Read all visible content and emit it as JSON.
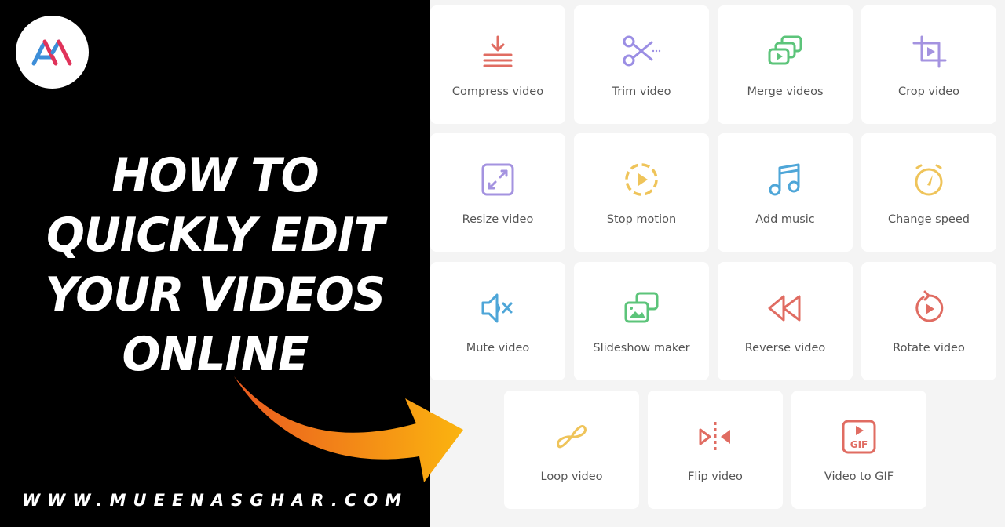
{
  "brand": {
    "logo_text": "AM",
    "logo_colors": {
      "a": "#3d8ed8",
      "m": "#e0335a"
    }
  },
  "headline": {
    "lines": [
      "HOW TO",
      "QUICKLY EDIT",
      "YOUR VIDEOS",
      "ONLINE"
    ]
  },
  "website": "WWW.MUEENASGHAR.COM",
  "arrow": {
    "gradient_start": "#ea5a1f",
    "gradient_end": "#fbb40f"
  },
  "tools": [
    {
      "label": "Compress video",
      "icon": "compress-icon",
      "color": "#e06c62"
    },
    {
      "label": "Trim video",
      "icon": "scissors-icon",
      "color": "#9b8ee4"
    },
    {
      "label": "Merge videos",
      "icon": "merge-icon",
      "color": "#5cc47a"
    },
    {
      "label": "Crop video",
      "icon": "crop-icon",
      "color": "#a493e0"
    },
    {
      "label": "Resize video",
      "icon": "resize-icon",
      "color": "#a493e0"
    },
    {
      "label": "Stop motion",
      "icon": "stop-motion-icon",
      "color": "#efc45a"
    },
    {
      "label": "Add music",
      "icon": "music-note-icon",
      "color": "#4ea6d8"
    },
    {
      "label": "Change speed",
      "icon": "stopwatch-icon",
      "color": "#efc45a"
    },
    {
      "label": "Mute video",
      "icon": "mute-icon",
      "color": "#4ea6d8"
    },
    {
      "label": "Slideshow maker",
      "icon": "slideshow-icon",
      "color": "#5cc47a"
    },
    {
      "label": "Reverse video",
      "icon": "rewind-icon",
      "color": "#e06c62"
    },
    {
      "label": "Rotate video",
      "icon": "rotate-icon",
      "color": "#e06c62"
    },
    {
      "label": "Loop video",
      "icon": "loop-icon",
      "color": "#efc45a"
    },
    {
      "label": "Flip video",
      "icon": "flip-icon",
      "color": "#e06c62"
    },
    {
      "label": "Video to GIF",
      "icon": "gif-icon",
      "color": "#e06c62"
    }
  ]
}
